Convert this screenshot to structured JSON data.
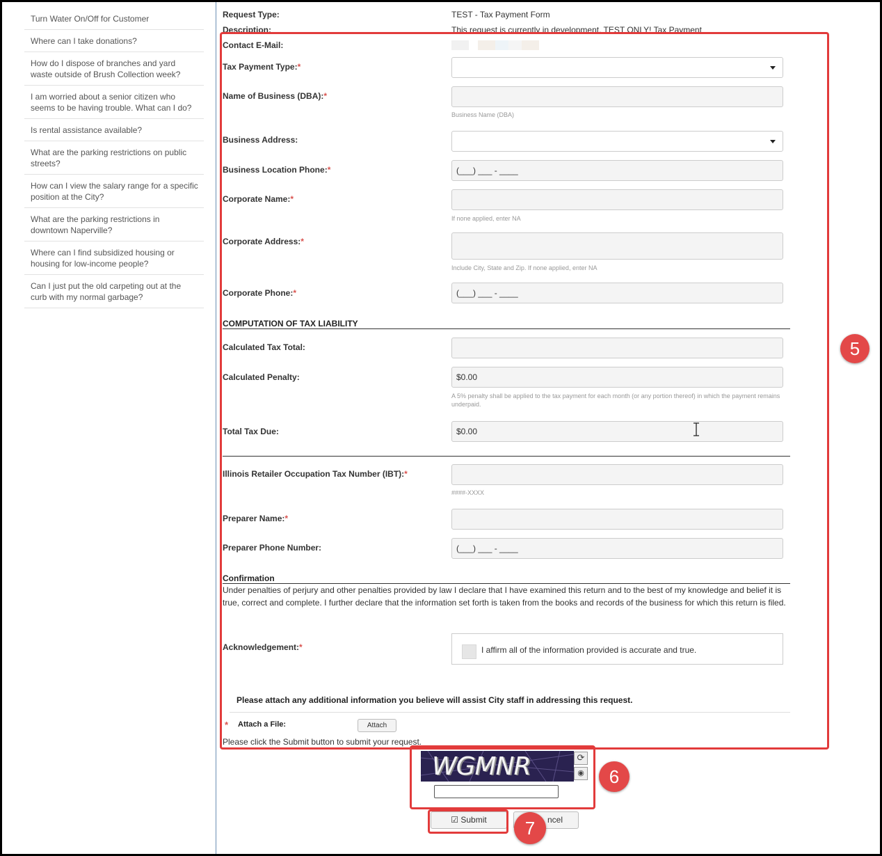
{
  "sidebar": {
    "items": [
      {
        "label": "Turn Water On/Off for Customer"
      },
      {
        "label": "Where can I take donations?"
      },
      {
        "label": "How do I dispose of branches and yard waste outside of Brush Collection week?"
      },
      {
        "label": "I am worried about a senior citizen who seems to be having trouble. What can I do?"
      },
      {
        "label": "Is rental assistance available?"
      },
      {
        "label": "What are the parking restrictions on public streets?"
      },
      {
        "label": "How can I view the salary range for a specific position at the City?"
      },
      {
        "label": "What are the parking restrictions in downtown Naperville?"
      },
      {
        "label": "Where can I find subsidized housing or housing for low-income people?"
      },
      {
        "label": "Can I just put the old carpeting out at the curb with my normal garbage?"
      }
    ]
  },
  "header": {
    "request_type_label": "Request Type:",
    "request_type_value": "TEST - Tax Payment Form",
    "description_label": "Description:",
    "description_value": "This request is currently in development. TEST ONLY! Tax Payment"
  },
  "form": {
    "contact_email_label": "Contact E-Mail:",
    "tax_payment_type_label": "Tax Payment Type:",
    "business_name_label": "Name of Business (DBA):",
    "business_name_hint": "Business Name (DBA)",
    "business_address_label": "Business Address:",
    "business_phone_label": "Business Location Phone:",
    "business_phone_value": "(___) ___ - ____",
    "corporate_name_label": "Corporate Name:",
    "corporate_name_hint": "If none applied, enter NA",
    "corporate_address_label": "Corporate Address:",
    "corporate_address_hint": "Include City, State and Zip. If none applied, enter NA",
    "corporate_phone_label": "Corporate Phone:",
    "corporate_phone_value": "(___) ___ - ____",
    "computation_heading": "COMPUTATION OF TAX LIABILITY",
    "calc_tax_total_label": "Calculated Tax Total:",
    "calc_penalty_label": "Calculated Penalty:",
    "calc_penalty_value": "$0.00",
    "penalty_hint": "A 5% penalty shall be applied to the tax payment for each month (or any portion thereof) in which the payment remains underpaid.",
    "total_tax_due_label": "Total Tax Due:",
    "total_tax_due_value": "$0.00",
    "ibt_label": "Illinois Retailer Occupation Tax Number (IBT):",
    "ibt_hint": "####-XXXX",
    "preparer_name_label": "Preparer Name:",
    "preparer_phone_label": "Preparer Phone Number:",
    "preparer_phone_value": "(___) ___ - ____",
    "confirmation_heading": "Confirmation",
    "confirmation_text": "Under penalties of perjury and other penalties provided by law I declare that I have examined this return and to the best of my knowledge and belief it is true, correct and complete. I further declare that the information set forth is taken from the books and records of the business for which this return is filed.",
    "acknowledgement_label": "Acknowledgement:",
    "acknowledgement_text": "I affirm all of the information provided is accurate and true.",
    "attach_info_text": "Please attach any additional information you believe will assist City staff in addressing this request.",
    "attach_label": "Attach a File:",
    "attach_button": "Attach",
    "submit_instruction": "Please click the Submit button to submit your request.",
    "required_mark": "*"
  },
  "captcha": {
    "text": "WGMNR"
  },
  "buttons": {
    "submit": "Submit",
    "cancel": "ncel"
  },
  "badges": {
    "five": "5",
    "six": "6",
    "seven": "7"
  },
  "colors": {
    "annotation_red": "#e23b3b",
    "required_red": "#d9534f",
    "captcha_bg": "#2a2250"
  }
}
